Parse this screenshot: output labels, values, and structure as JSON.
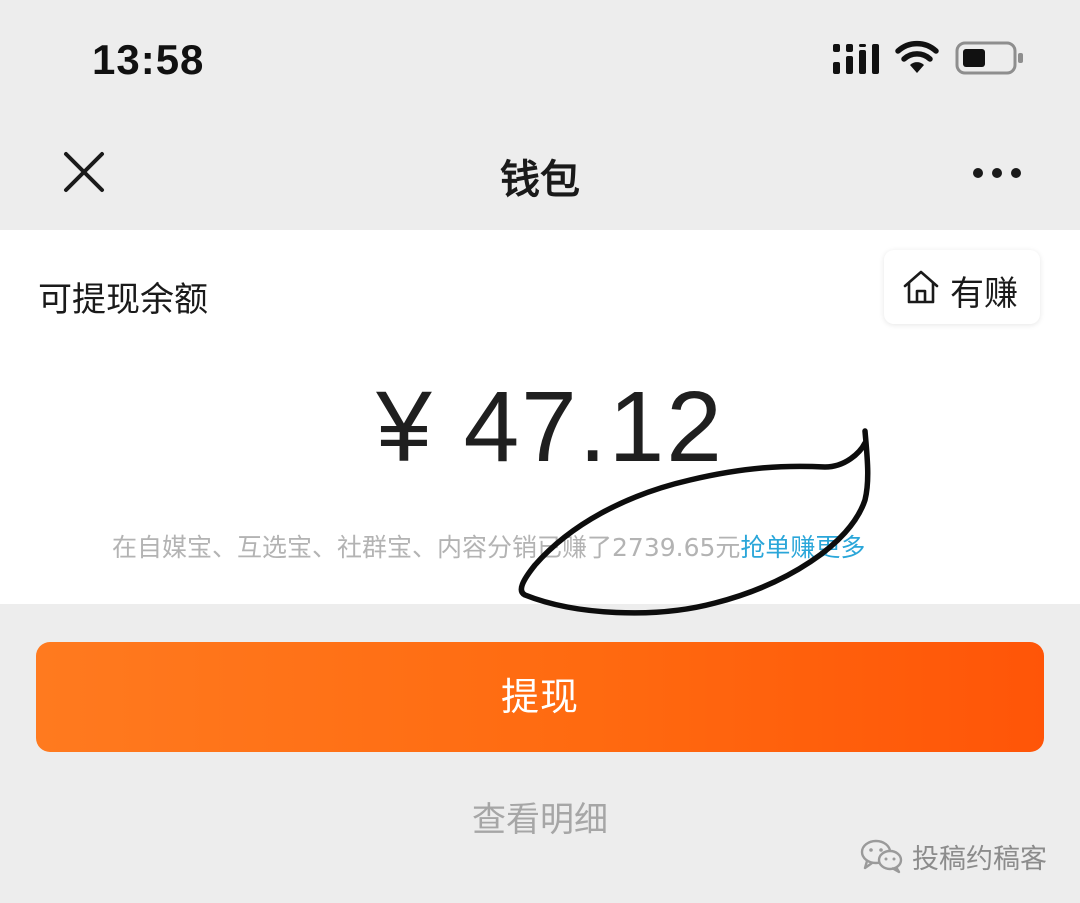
{
  "status_bar": {
    "time": "13:58"
  },
  "nav": {
    "title": "钱包"
  },
  "card": {
    "balance_label": "可提现余额",
    "youzhuan_label": "有赚",
    "amount": "¥ 47.12",
    "earnings_text": "在自媒宝、互选宝、社群宝、内容分销已赚了2739.65元",
    "earnings_link": "抢单赚更多"
  },
  "actions": {
    "withdraw_label": "提现",
    "detail_label": "查看明细"
  },
  "watermark": {
    "text": "投稿约稿客"
  },
  "colors": {
    "accent_orange": "#ff6a10",
    "link_blue": "#2aa6d9",
    "background": "#ededed"
  }
}
